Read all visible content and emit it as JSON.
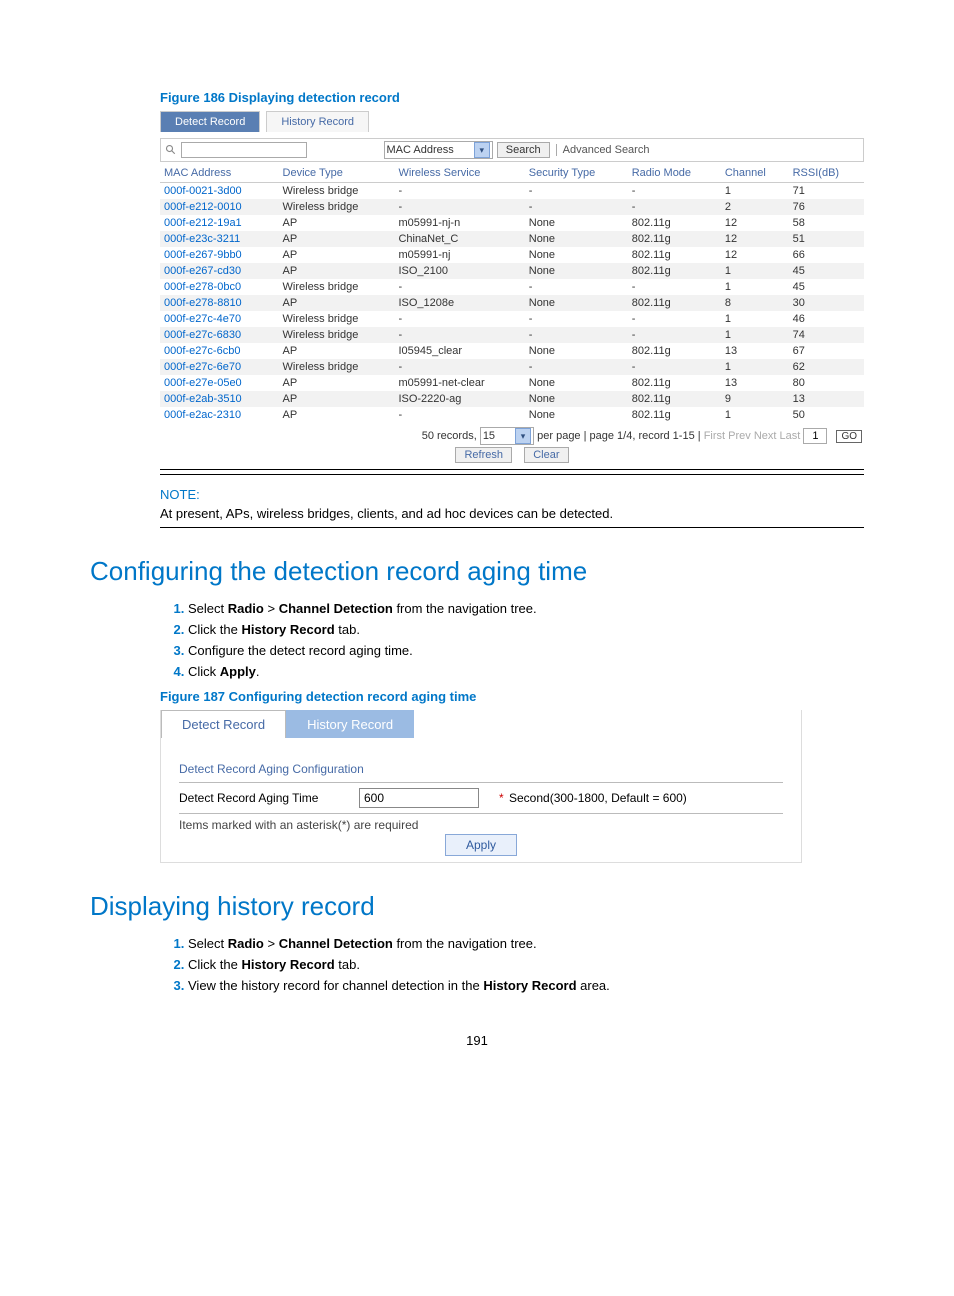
{
  "fig186": {
    "caption": "Figure 186 Displaying detection record",
    "tab_detect": "Detect Record",
    "tab_history": "History Record",
    "search_field": "MAC Address",
    "search_btn": "Search",
    "adv_search": "Advanced Search",
    "headers": [
      "MAC Address",
      "Device Type",
      "Wireless Service",
      "Security Type",
      "Radio Mode",
      "Channel",
      "RSSI(dB)"
    ],
    "rows": [
      {
        "mac": "000f-0021-3d00",
        "dev": "Wireless bridge",
        "svc": "-",
        "sec": "-",
        "radio": "-",
        "ch": "1",
        "rssi": "71"
      },
      {
        "mac": "000f-e212-0010",
        "dev": "Wireless bridge",
        "svc": "-",
        "sec": "-",
        "radio": "-",
        "ch": "2",
        "rssi": "76"
      },
      {
        "mac": "000f-e212-19a1",
        "dev": "AP",
        "svc": "m05991-nj-n",
        "sec": "None",
        "radio": "802.11g",
        "ch": "12",
        "rssi": "58"
      },
      {
        "mac": "000f-e23c-3211",
        "dev": "AP",
        "svc": "ChinaNet_C",
        "sec": "None",
        "radio": "802.11g",
        "ch": "12",
        "rssi": "51"
      },
      {
        "mac": "000f-e267-9bb0",
        "dev": "AP",
        "svc": "m05991-nj",
        "sec": "None",
        "radio": "802.11g",
        "ch": "12",
        "rssi": "66"
      },
      {
        "mac": "000f-e267-cd30",
        "dev": "AP",
        "svc": "ISO_2100",
        "sec": "None",
        "radio": "802.11g",
        "ch": "1",
        "rssi": "45"
      },
      {
        "mac": "000f-e278-0bc0",
        "dev": "Wireless bridge",
        "svc": "-",
        "sec": "-",
        "radio": "-",
        "ch": "1",
        "rssi": "45"
      },
      {
        "mac": "000f-e278-8810",
        "dev": "AP",
        "svc": "ISO_1208e",
        "sec": "None",
        "radio": "802.11g",
        "ch": "8",
        "rssi": "30"
      },
      {
        "mac": "000f-e27c-4e70",
        "dev": "Wireless bridge",
        "svc": "-",
        "sec": "-",
        "radio": "-",
        "ch": "1",
        "rssi": "46"
      },
      {
        "mac": "000f-e27c-6830",
        "dev": "Wireless bridge",
        "svc": "-",
        "sec": "-",
        "radio": "-",
        "ch": "1",
        "rssi": "74"
      },
      {
        "mac": "000f-e27c-6cb0",
        "dev": "AP",
        "svc": "I05945_clear",
        "sec": "None",
        "radio": "802.11g",
        "ch": "13",
        "rssi": "67"
      },
      {
        "mac": "000f-e27c-6e70",
        "dev": "Wireless bridge",
        "svc": "-",
        "sec": "-",
        "radio": "-",
        "ch": "1",
        "rssi": "62"
      },
      {
        "mac": "000f-e27e-05e0",
        "dev": "AP",
        "svc": "m05991-net-clear",
        "sec": "None",
        "radio": "802.11g",
        "ch": "13",
        "rssi": "80"
      },
      {
        "mac": "000f-e2ab-3510",
        "dev": "AP",
        "svc": "ISO-2220-ag",
        "sec": "None",
        "radio": "802.11g",
        "ch": "9",
        "rssi": "13"
      },
      {
        "mac": "000f-e2ac-2310",
        "dev": "AP",
        "svc": "-",
        "sec": "None",
        "radio": "802.11g",
        "ch": "1",
        "rssi": "50"
      }
    ],
    "pager_prefix": "50 records,",
    "page_size": "15",
    "pager_mid": "per page | page 1/4, record 1-15 |",
    "nav_first": "First",
    "nav_prev": "Prev",
    "nav_next": "Next",
    "nav_last": "Last",
    "page_input": "1",
    "go": "GO",
    "btn_refresh": "Refresh",
    "btn_clear": "Clear"
  },
  "note": {
    "heading": "NOTE:",
    "text": "At present, APs, wireless bridges, clients, and ad hoc devices can be detected."
  },
  "section_cfg": {
    "heading": "Configuring the detection record aging time",
    "steps": [
      {
        "pre": "Select ",
        "b1": "Radio",
        "mid": " > ",
        "b2": "Channel Detection",
        "post": " from the navigation tree."
      },
      {
        "pre": "Click the ",
        "b1": "History Record",
        "mid": "",
        "b2": "",
        "post": " tab."
      },
      {
        "plain": "Configure the detect record aging time."
      },
      {
        "pre": "Click ",
        "b1": "Apply",
        "mid": "",
        "b2": "",
        "post": "."
      }
    ]
  },
  "fig187": {
    "caption": "Figure 187 Configuring detection record aging time",
    "tab_detect": "Detect Record",
    "tab_history": "History Record",
    "cfg_title": "Detect Record Aging Configuration",
    "lbl": "Detect Record Aging Time",
    "val": "600",
    "hint": " Second(300-1800, Default = 600)",
    "req_note": "Items marked with an asterisk(*) are required",
    "apply": "Apply"
  },
  "section_history": {
    "heading": "Displaying history record",
    "steps": [
      {
        "pre": "Select ",
        "b1": "Radio",
        "mid": " > ",
        "b2": "Channel Detection",
        "post": " from the navigation tree."
      },
      {
        "pre": "Click the ",
        "b1": "History Record",
        "mid": "",
        "b2": "",
        "post": " tab."
      },
      {
        "pre": "View the history record for channel detection in the ",
        "b1": "History Record",
        "mid": "",
        "b2": "",
        "post": " area."
      }
    ]
  },
  "page_number": "191"
}
